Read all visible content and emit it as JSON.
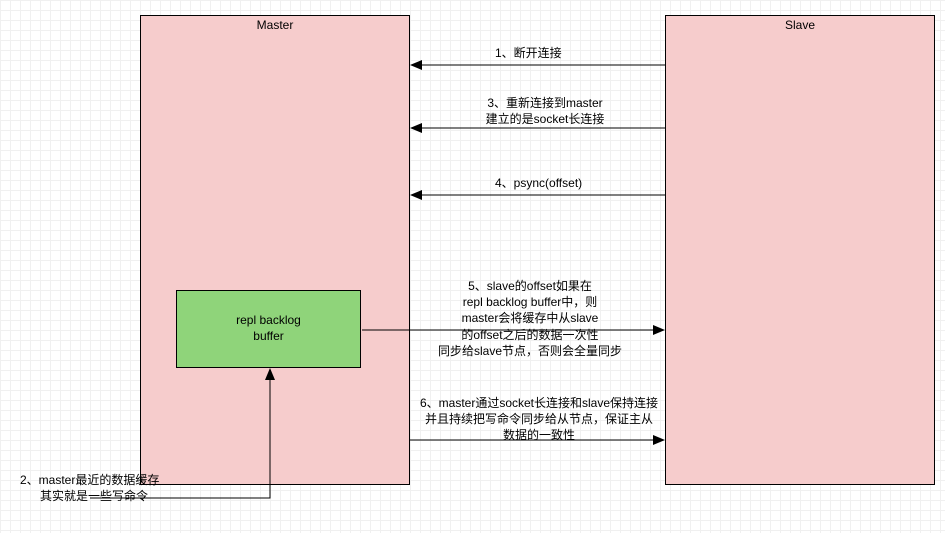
{
  "boxes": {
    "master": "Master",
    "slave": "Slave",
    "repl": "repl backlog\nbuffer"
  },
  "labels": {
    "l1": "1、断开连接",
    "l3a": "3、重新连接到master",
    "l3b": "建立的是socket长连接",
    "l4": "4、psync(offset)",
    "l5a": "5、slave的offset如果在",
    "l5b": "repl backlog buffer中，则",
    "l5c": "master会将缓存中从slave",
    "l5d": "的offset之后的数据一次性",
    "l5e": "同步给slave节点，否则会全量同步",
    "l6a": "6、master通过socket长连接和slave保持连接",
    "l6b": "并且持续把写命令同步给从节点，保证主从",
    "l6c": "数据的一致性",
    "l2a": "2、master最近的数据缓存",
    "l2b": "其实就是一些写命令"
  }
}
